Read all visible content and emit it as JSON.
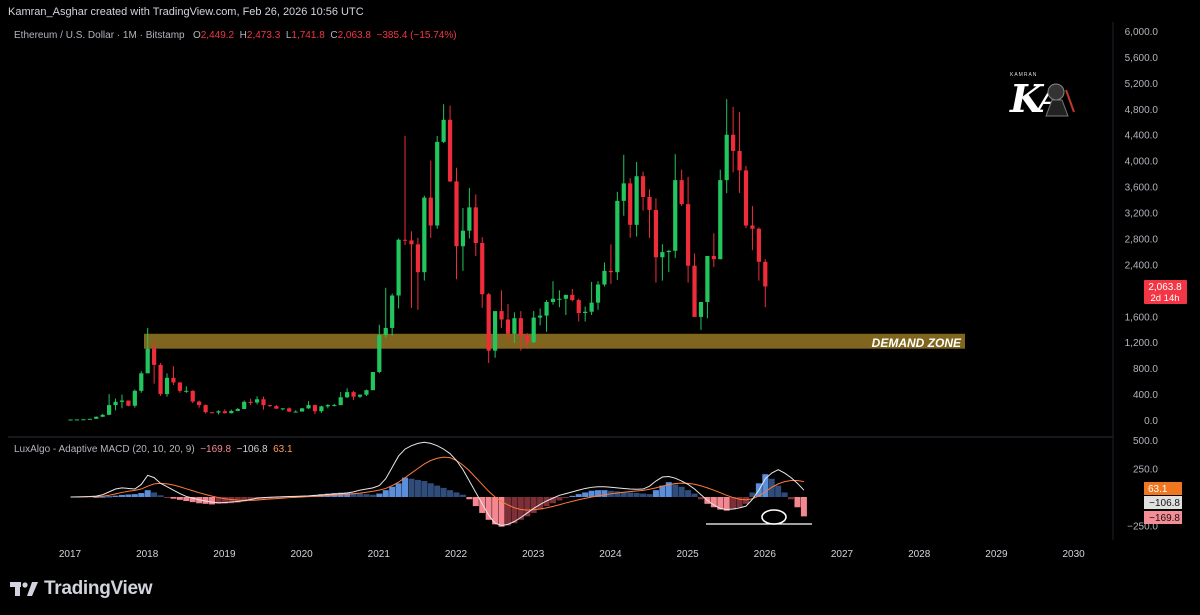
{
  "header": {
    "credit": "Kamran_Asghar created with TradingView.com, Feb 26, 2026 10:56 UTC",
    "symbol": "Ethereum / U.S. Dollar · 1M · Bitstamp",
    "o_label": "O",
    "o_value": "2,449.2",
    "h_label": "H",
    "h_value": "2,473.3",
    "l_label": "L",
    "l_value": "1,741.8",
    "c_label": "C",
    "c_value": "2,063.8",
    "change": "−385.4 (−15.74%)"
  },
  "logo": {
    "text": "KA",
    "small_text": "KAMRAN"
  },
  "price_tag": {
    "price": "2,063.8",
    "countdown": "2d 14h",
    "color": "#f23645"
  },
  "macd_legend": {
    "name": "LuxAlgo - Adaptive MACD (20, 10, 20, 9)",
    "v1": "−169.8",
    "v2": "−106.8",
    "v3": "63.1"
  },
  "macd_tags": {
    "t1": "63.1",
    "t2": "−106.8",
    "t3": "−169.8"
  },
  "annotation": {
    "demand_zone": "DEMAND ZONE"
  },
  "footer": {
    "brand": "TradingView"
  },
  "colors": {
    "up": "#22c55e",
    "down": "#ef2d3a",
    "zone": "#8a6e1f",
    "macd_line": "#e8e8e8",
    "signal_line": "#ff7a3c",
    "hist_pos": "#5b8fdc",
    "hist_neg": "#f4878f"
  },
  "chart_data": [
    {
      "type": "candlestick",
      "title": "Ethereum / U.S. Dollar · 1M · Bitstamp",
      "y_ticks": [
        "6,000.0",
        "5,600.0",
        "5,200.0",
        "4,800.0",
        "4,400.0",
        "4,000.0",
        "3,600.0",
        "3,200.0",
        "2,800.0",
        "2,400.0",
        "1,600.0",
        "1,200.0",
        "800.0",
        "400.0",
        "0.0"
      ],
      "ylim": [
        0,
        6000
      ],
      "x_ticks": [
        "2017",
        "2018",
        "2019",
        "2020",
        "2021",
        "2022",
        "2023",
        "2024",
        "2025",
        "2026",
        "2027",
        "2028",
        "2029",
        "2030"
      ],
      "demand_zone": [
        1100,
        1330
      ],
      "candles": [
        [
          8,
          8,
          8,
          8
        ],
        [
          8,
          9,
          8,
          9
        ],
        [
          10,
          12,
          9,
          11
        ],
        [
          11,
          20,
          11,
          18
        ],
        [
          18,
          55,
          17,
          50
        ],
        [
          50,
          95,
          45,
          80
        ],
        [
          80,
          400,
          75,
          230
        ],
        [
          230,
          330,
          150,
          280
        ],
        [
          280,
          390,
          180,
          300
        ],
        [
          300,
          300,
          210,
          220
        ],
        [
          220,
          470,
          190,
          450
        ],
        [
          450,
          750,
          420,
          720
        ],
        [
          720,
          1420,
          720,
          1100
        ],
        [
          1100,
          1200,
          560,
          850
        ],
        [
          850,
          880,
          370,
          400
        ],
        [
          400,
          720,
          360,
          650
        ],
        [
          650,
          830,
          540,
          580
        ],
        [
          580,
          580,
          420,
          450
        ],
        [
          450,
          520,
          420,
          450
        ],
        [
          450,
          460,
          260,
          285
        ],
        [
          285,
          300,
          190,
          230
        ],
        [
          230,
          240,
          100,
          120
        ],
        [
          120,
          120,
          100,
          115
        ],
        [
          115,
          150,
          85,
          135
        ],
        [
          135,
          165,
          100,
          105
        ],
        [
          105,
          160,
          100,
          140
        ],
        [
          140,
          185,
          135,
          170
        ],
        [
          170,
          300,
          165,
          280
        ],
        [
          280,
          330,
          230,
          270
        ],
        [
          270,
          365,
          240,
          320
        ],
        [
          320,
          360,
          160,
          230
        ],
        [
          230,
          230,
          200,
          215
        ],
        [
          215,
          230,
          170,
          175
        ],
        [
          175,
          180,
          150,
          180
        ],
        [
          180,
          195,
          120,
          130
        ],
        [
          130,
          150,
          125,
          130
        ],
        [
          130,
          185,
          130,
          180
        ],
        [
          180,
          290,
          170,
          230
        ],
        [
          230,
          240,
          90,
          135
        ],
        [
          135,
          220,
          110,
          210
        ],
        [
          210,
          245,
          180,
          230
        ],
        [
          230,
          250,
          210,
          230
        ],
        [
          230,
          430,
          230,
          350
        ],
        [
          350,
          490,
          340,
          430
        ],
        [
          430,
          450,
          310,
          360
        ],
        [
          360,
          395,
          340,
          390
        ],
        [
          390,
          470,
          370,
          460
        ],
        [
          460,
          620,
          460,
          740
        ],
        [
          740,
          1470,
          720,
          1310
        ],
        [
          1310,
          2040,
          1270,
          1420
        ],
        [
          1420,
          1950,
          1300,
          1920
        ],
        [
          1920,
          2800,
          1720,
          2780
        ],
        [
          2780,
          4380,
          2700,
          2770
        ],
        [
          2770,
          2910,
          1730,
          2710
        ],
        [
          2710,
          2810,
          1700,
          2280
        ],
        [
          2280,
          3460,
          2150,
          3430
        ],
        [
          3430,
          4000,
          2810,
          3000
        ],
        [
          3000,
          4380,
          2950,
          4290
        ],
        [
          4290,
          4870,
          4270,
          4630
        ],
        [
          4630,
          4850,
          3670,
          3680
        ],
        [
          3680,
          3890,
          2170,
          2680
        ],
        [
          2680,
          3270,
          2300,
          2920
        ],
        [
          2920,
          3580,
          2800,
          3280
        ],
        [
          3280,
          3480,
          2530,
          2730
        ],
        [
          2730,
          2820,
          1730,
          1940
        ],
        [
          1940,
          1960,
          880,
          1070
        ],
        [
          1070,
          1290,
          960,
          1680
        ],
        [
          1680,
          2000,
          1420,
          1550
        ],
        [
          1550,
          1790,
          1220,
          1330
        ],
        [
          1330,
          1660,
          1190,
          1570
        ],
        [
          1570,
          1680,
          1070,
          1300
        ],
        [
          1300,
          1340,
          1100,
          1200
        ],
        [
          1200,
          1680,
          1190,
          1580
        ],
        [
          1580,
          1720,
          1460,
          1610
        ],
        [
          1610,
          1850,
          1360,
          1820
        ],
        [
          1820,
          2140,
          1780,
          1870
        ],
        [
          1870,
          2000,
          1740,
          1870
        ],
        [
          1870,
          1930,
          1620,
          1930
        ],
        [
          1930,
          2020,
          1830,
          1850
        ],
        [
          1850,
          1870,
          1520,
          1650
        ],
        [
          1650,
          1750,
          1520,
          1670
        ],
        [
          1670,
          2130,
          1620,
          1810
        ],
        [
          1810,
          2140,
          1700,
          2090
        ],
        [
          2090,
          2430,
          2060,
          2300
        ],
        [
          2300,
          2710,
          2100,
          2280
        ],
        [
          2280,
          3520,
          2160,
          3380
        ],
        [
          3380,
          4090,
          3150,
          3650
        ],
        [
          3650,
          3730,
          2810,
          3010
        ],
        [
          3010,
          3980,
          2830,
          3760
        ],
        [
          3760,
          3830,
          3230,
          3440
        ],
        [
          3440,
          3560,
          2810,
          3240
        ],
        [
          3240,
          3420,
          2120,
          2510
        ],
        [
          2510,
          2710,
          2150,
          2590
        ],
        [
          2590,
          2620,
          2280,
          2610
        ],
        [
          2610,
          4100,
          2500,
          3700
        ],
        [
          3700,
          3860,
          3300,
          3330
        ],
        [
          3330,
          3750,
          2120,
          2380
        ],
        [
          2380,
          2570,
          1750,
          1590
        ],
        [
          1590,
          1690,
          1390,
          1820
        ],
        [
          1820,
          2450,
          1570,
          2530
        ],
        [
          2530,
          2880,
          2360,
          2480
        ],
        [
          2480,
          3860,
          2480,
          3700
        ],
        [
          3700,
          4950,
          3500,
          4400
        ],
        [
          4400,
          4830,
          3820,
          4150
        ],
        [
          4150,
          4750,
          3500,
          3850
        ],
        [
          3850,
          3920,
          2960,
          3000
        ],
        [
          3000,
          3300,
          2620,
          2950
        ],
        [
          2950,
          2970,
          2150,
          2440
        ],
        [
          2440,
          2480,
          1740,
          2060
        ]
      ]
    },
    {
      "type": "macd",
      "title": "LuxAlgo - Adaptive MACD (20, 10, 20, 9)",
      "y_ticks": [
        "500.0",
        "250.0",
        "−250.0"
      ],
      "ylim": [
        -300,
        500
      ],
      "histogram": [
        0,
        0,
        0,
        0,
        1,
        3,
        6,
        12,
        18,
        22,
        25,
        35,
        60,
        40,
        15,
        -5,
        -15,
        -25,
        -35,
        -45,
        -55,
        -60,
        -65,
        -62,
        -60,
        -55,
        -50,
        -40,
        -30,
        -25,
        -20,
        -15,
        -10,
        -5,
        0,
        5,
        8,
        12,
        18,
        25,
        30,
        35,
        38,
        40,
        35,
        30,
        25,
        20,
        30,
        60,
        90,
        120,
        170,
        160,
        150,
        140,
        120,
        100,
        80,
        60,
        40,
        20,
        -20,
        -80,
        -140,
        -200,
        -240,
        -260,
        -250,
        -230,
        -200,
        -170,
        -140,
        -110,
        -80,
        -55,
        -30,
        -10,
        10,
        25,
        40,
        55,
        60,
        60,
        55,
        50,
        45,
        40,
        35,
        30,
        25,
        60,
        100,
        130,
        110,
        90,
        60,
        30,
        -20,
        -60,
        -90,
        -110,
        -120,
        -110,
        -90,
        -60,
        40,
        120,
        200,
        160,
        100,
        40,
        -20,
        -90,
        -170
      ],
      "macd_line": [
        0,
        1,
        2,
        4,
        8,
        20,
        45,
        70,
        80,
        75,
        70,
        110,
        190,
        170,
        120,
        90,
        60,
        30,
        5,
        -10,
        -25,
        -35,
        -45,
        -50,
        -48,
        -44,
        -40,
        -32,
        -22,
        -10,
        -5,
        -2,
        0,
        2,
        4,
        6,
        8,
        10,
        14,
        18,
        22,
        26,
        30,
        35,
        45,
        60,
        70,
        80,
        100,
        160,
        260,
        360,
        420,
        450,
        470,
        480,
        470,
        450,
        420,
        380,
        320,
        240,
        140,
        40,
        -60,
        -160,
        -230,
        -250,
        -240,
        -215,
        -180,
        -140,
        -100,
        -65,
        -35,
        -10,
        15,
        30,
        45,
        60,
        75,
        85,
        90,
        90,
        85,
        80,
        75,
        70,
        68,
        70,
        95,
        140,
        175,
        180,
        165,
        140,
        110,
        70,
        20,
        -30,
        -70,
        -100,
        -110,
        -105,
        -95,
        -80,
        -20,
        60,
        160,
        210,
        240,
        210,
        170,
        120,
        60
      ],
      "signal_line": [
        0,
        0,
        1,
        2,
        3,
        7,
        15,
        27,
        40,
        50,
        58,
        70,
        95,
        115,
        120,
        115,
        105,
        90,
        72,
        55,
        38,
        22,
        8,
        -5,
        -15,
        -22,
        -27,
        -30,
        -30,
        -27,
        -22,
        -18,
        -14,
        -10,
        -6,
        -3,
        0,
        3,
        6,
        9,
        12,
        15,
        19,
        23,
        28,
        34,
        42,
        50,
        60,
        75,
        100,
        130,
        170,
        210,
        250,
        290,
        320,
        340,
        350,
        345,
        320,
        280,
        230,
        170,
        110,
        50,
        0,
        -40,
        -70,
        -95,
        -110,
        -115,
        -112,
        -105,
        -95,
        -82,
        -68,
        -52,
        -38,
        -24,
        -12,
        0,
        10,
        20,
        28,
        35,
        42,
        48,
        53,
        58,
        68,
        80,
        95,
        108,
        118,
        122,
        120,
        112,
        98,
        80,
        60,
        38,
        15,
        -5,
        -20,
        -25,
        -15,
        10,
        45,
        85,
        115,
        135,
        145,
        145,
        135
      ]
    }
  ]
}
